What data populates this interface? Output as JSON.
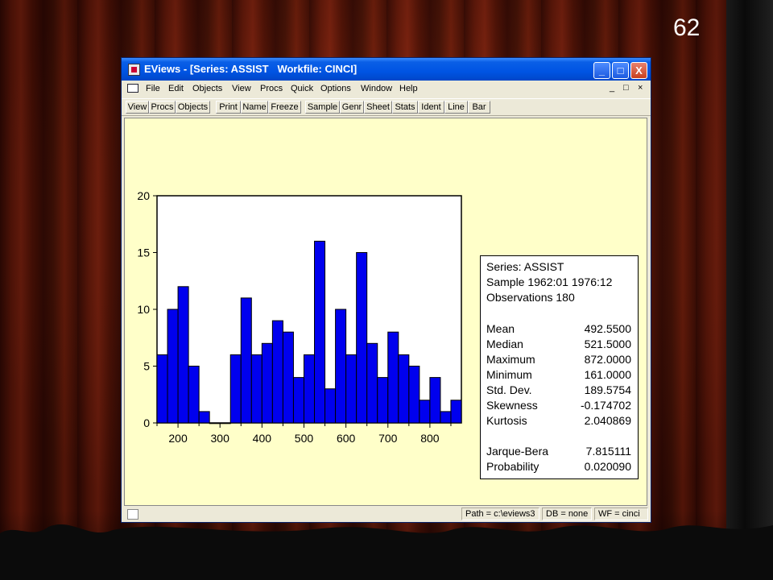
{
  "slide": {
    "number": "62"
  },
  "window": {
    "title": "EViews - [Series: ASSIST   Workfile: CINCI]",
    "controls": [
      "_",
      "□",
      "X"
    ]
  },
  "menu": {
    "items": [
      "File",
      "Edit",
      "Objects",
      "View",
      "Procs",
      "Quick",
      "Options",
      "Window",
      "Help"
    ],
    "mdi_controls": [
      "_",
      "□",
      "×"
    ]
  },
  "toolbar": {
    "buttons": [
      "View",
      "Procs",
      "Objects",
      "Print",
      "Name",
      "Freeze",
      "Sample",
      "Genr",
      "Sheet",
      "Stats",
      "Ident",
      "Line",
      "Bar"
    ]
  },
  "stats": {
    "header": [
      "Series: ASSIST",
      "Sample 1962:01 1976:12",
      "Observations 180"
    ],
    "rows": [
      {
        "label": "Mean",
        "value": "492.5500"
      },
      {
        "label": "Median",
        "value": "521.5000"
      },
      {
        "label": "Maximum",
        "value": "872.0000"
      },
      {
        "label": "Minimum",
        "value": "161.0000"
      },
      {
        "label": "Std. Dev.",
        "value": "189.5754"
      },
      {
        "label": "Skewness",
        "value": "-0.174702"
      },
      {
        "label": "Kurtosis",
        "value": "2.040869"
      }
    ],
    "tests": [
      {
        "label": "Jarque-Bera",
        "value": "7.815111"
      },
      {
        "label": "Probability",
        "value": "0.020090"
      }
    ]
  },
  "status": {
    "path": "Path = c:\\eviews3",
    "db": "DB = none",
    "wf": "WF = cinci"
  },
  "chart_data": {
    "type": "bar",
    "title": "",
    "xlabel": "",
    "ylabel": "",
    "bar_color": "#0000ee",
    "bin_width": 25,
    "x": [
      162.5,
      187.5,
      212.5,
      237.5,
      262.5,
      287.5,
      312.5,
      337.5,
      362.5,
      387.5,
      412.5,
      437.5,
      462.5,
      487.5,
      512.5,
      537.5,
      562.5,
      587.5,
      612.5,
      637.5,
      662.5,
      687.5,
      712.5,
      737.5,
      762.5,
      787.5,
      812.5,
      837.5,
      862.5
    ],
    "values": [
      6,
      10,
      12,
      5,
      1,
      0,
      0,
      6,
      11,
      6,
      7,
      9,
      8,
      4,
      6,
      16,
      3,
      10,
      6,
      15,
      7,
      4,
      8,
      6,
      5,
      2,
      4,
      1,
      2
    ],
    "xlim": [
      150,
      875
    ],
    "ylim": [
      0,
      20
    ],
    "xticks": [
      "200",
      "300",
      "400",
      "500",
      "600",
      "700",
      "800"
    ],
    "yticks": [
      "0",
      "5",
      "10",
      "15",
      "20"
    ],
    "grid": false
  }
}
